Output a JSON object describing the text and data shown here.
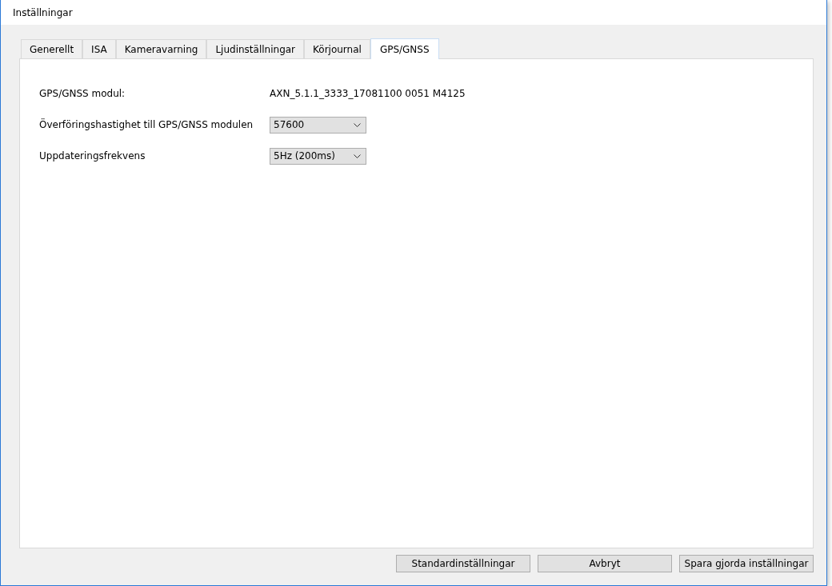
{
  "window": {
    "title": "Inställningar"
  },
  "tabs": [
    {
      "label": "Generellt",
      "selected": false
    },
    {
      "label": "ISA",
      "selected": false
    },
    {
      "label": "Kameravarning",
      "selected": false
    },
    {
      "label": "Ljudinställningar",
      "selected": false
    },
    {
      "label": "Körjournal",
      "selected": false
    },
    {
      "label": "GPS/GNSS",
      "selected": true
    }
  ],
  "fields": [
    {
      "kind": "text",
      "label": "GPS/GNSS modul:",
      "value": "AXN_5.1.1_3333_17081100 0051 M4125"
    },
    {
      "kind": "dropdown",
      "label": "Överföringshastighet till GPS/GNSS modulen",
      "value": "57600"
    },
    {
      "kind": "dropdown",
      "label": "Uppdateringsfrekvens",
      "value": "5Hz (200ms)"
    }
  ],
  "buttons": [
    "Standardinställningar",
    "Avbryt",
    "Spara gjorda inställningar"
  ]
}
